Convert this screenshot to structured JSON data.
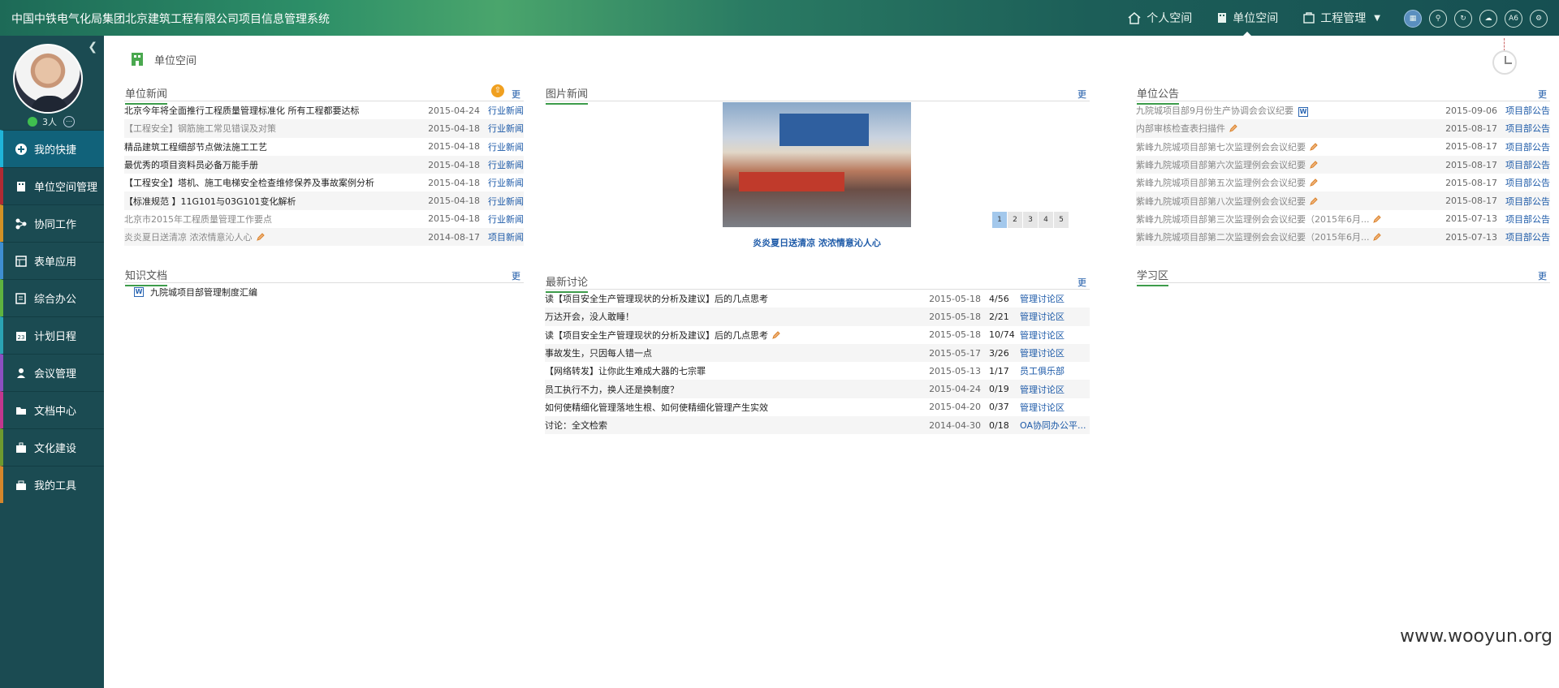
{
  "header": {
    "title": "中国中铁电气化局集团北京建筑工程有限公司项目信息管理系统",
    "nav": [
      "个人空间",
      "单位空间",
      "工程管理"
    ],
    "tool_badge": "A6"
  },
  "sidebar": {
    "online_count": "3人",
    "items": [
      "我的快捷",
      "单位空间管理",
      "协同工作",
      "表单应用",
      "综合办公",
      "计划日程",
      "会议管理",
      "文档中心",
      "文化建设",
      "我的工具"
    ]
  },
  "page": {
    "title": "单位空间"
  },
  "unit_news": {
    "title": "单位新闻",
    "more": "更",
    "rows": [
      {
        "title": "北京今年将全面推行工程质量管理标准化 所有工程都要达标",
        "date": "2015-04-24",
        "cat": "行业新闻"
      },
      {
        "title": "【工程安全】钢筋施工常见错误及对策",
        "date": "2015-04-18",
        "cat": "行业新闻"
      },
      {
        "title": "精品建筑工程细部节点做法施工工艺",
        "date": "2015-04-18",
        "cat": "行业新闻"
      },
      {
        "title": "最优秀的项目资料员必备万能手册",
        "date": "2015-04-18",
        "cat": "行业新闻"
      },
      {
        "title": "【工程安全】塔机、施工电梯安全检查维修保养及事故案例分析",
        "date": "2015-04-18",
        "cat": "行业新闻"
      },
      {
        "title": "【标准规范 】11G101与03G101变化解析",
        "date": "2015-04-18",
        "cat": "行业新闻"
      },
      {
        "title": "北京市2015年工程质量管理工作要点",
        "date": "2015-04-18",
        "cat": "行业新闻"
      },
      {
        "title": "炎炎夏日送清凉 浓浓情意沁人心",
        "date": "2014-08-17",
        "cat": "项目新闻"
      }
    ]
  },
  "photo_news": {
    "title": "图片新闻",
    "more": "更",
    "caption": "炎炎夏日送清凉 浓浓情意沁人心",
    "pages": [
      "1",
      "2",
      "3",
      "4",
      "5"
    ]
  },
  "announcements": {
    "title": "单位公告",
    "more": "更",
    "rows": [
      {
        "title": "九院城项目部9月份生产协调会会议纪要",
        "date": "2015-09-06",
        "cat": "项目部公告"
      },
      {
        "title": "内部审核检查表扫描件",
        "date": "2015-08-17",
        "cat": "项目部公告"
      },
      {
        "title": "紫峰九院城项目部第七次监理例会会议纪要",
        "date": "2015-08-17",
        "cat": "项目部公告"
      },
      {
        "title": "紫峰九院城项目部第六次监理例会会议纪要",
        "date": "2015-08-17",
        "cat": "项目部公告"
      },
      {
        "title": "紫峰九院城项目部第五次监理例会会议纪要",
        "date": "2015-08-17",
        "cat": "项目部公告"
      },
      {
        "title": "紫峰九院城项目部第八次监理例会会议纪要",
        "date": "2015-08-17",
        "cat": "项目部公告"
      },
      {
        "title": "紫峰九院城项目部第三次监理例会会议纪要（2015年6月...",
        "date": "2015-07-13",
        "cat": "项目部公告"
      },
      {
        "title": "紫峰九院城项目部第二次监理例会会议纪要（2015年6月...",
        "date": "2015-07-13",
        "cat": "项目部公告"
      }
    ]
  },
  "knowledge": {
    "title": "知识文档",
    "more": "更",
    "rows": [
      {
        "title": "九院城项目部管理制度汇编"
      }
    ]
  },
  "discussion": {
    "title": "最新讨论",
    "more": "更",
    "rows": [
      {
        "title": "读【项目安全生产管理现状的分析及建议】后的几点思考",
        "date": "2015-05-18",
        "count": "4/56",
        "cat": "管理讨论区"
      },
      {
        "title": "万达开会，没人敢睡！",
        "date": "2015-05-18",
        "count": "2/21",
        "cat": "管理讨论区"
      },
      {
        "title": "读【项目安全生产管理现状的分析及建议】后的几点思考",
        "date": "2015-05-18",
        "count": "10/74",
        "cat": "管理讨论区"
      },
      {
        "title": "事故发生，只因每人错一点",
        "date": "2015-05-17",
        "count": "3/26",
        "cat": "管理讨论区"
      },
      {
        "title": "【网络转发】让你此生难成大器的七宗罪",
        "date": "2015-05-13",
        "count": "1/17",
        "cat": "员工俱乐部"
      },
      {
        "title": "员工执行不力，换人还是换制度？",
        "date": "2015-04-24",
        "count": "0/19",
        "cat": "管理讨论区"
      },
      {
        "title": "如何使精细化管理落地生根、如何使精细化管理产生实效",
        "date": "2015-04-20",
        "count": "0/37",
        "cat": "管理讨论区"
      },
      {
        "title": "讨论：全文检索",
        "date": "2014-04-30",
        "count": "0/18",
        "cat": "OA协同办公平..."
      }
    ]
  },
  "study": {
    "title": "学习区",
    "more": "更"
  },
  "watermark": "www.wooyun.org"
}
